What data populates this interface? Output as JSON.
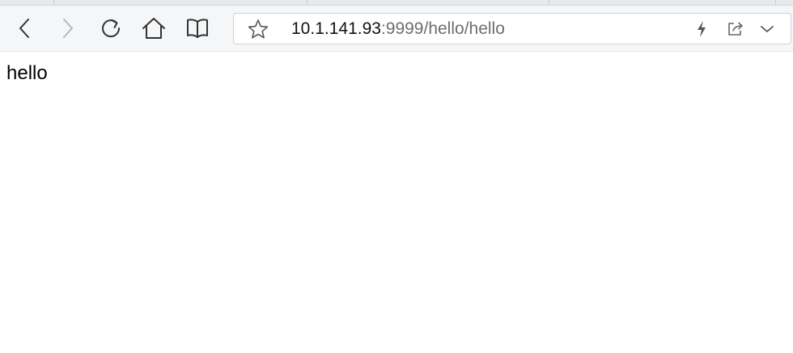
{
  "browser": {
    "toolbar": {
      "back_icon": "chevron-left-icon",
      "forward_icon": "chevron-right-icon",
      "reload_icon": "reload-icon",
      "home_icon": "home-icon",
      "reader_icon": "book-icon"
    },
    "address_bar": {
      "bookmark_icon": "star-icon",
      "url_host": "10.1.141.93",
      "url_rest": ":9999/hello/hello",
      "accelerate_icon": "lightning-icon",
      "share_icon": "share-icon",
      "dropdown_icon": "chevron-down-icon"
    }
  },
  "page": {
    "body_text": "hello"
  },
  "colors": {
    "toolbar_bg": "#f5f6f7",
    "tabstrip_bg": "#e8e9ec",
    "icon_active": "#333333",
    "icon_disabled": "#b8b8b8",
    "url_host": "#111111",
    "url_rest": "#6e6e6e"
  }
}
